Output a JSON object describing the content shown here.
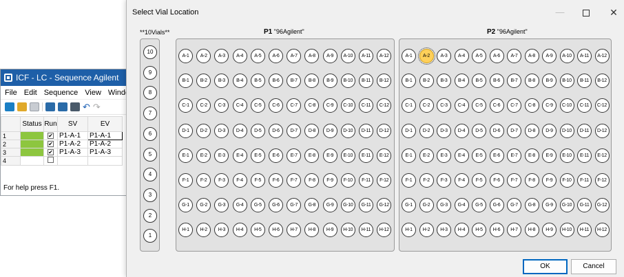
{
  "background_window": {
    "title": "ICF - LC - Sequence Agilent",
    "menu": [
      "File",
      "Edit",
      "Sequence",
      "View",
      "Windo"
    ],
    "columns": [
      "",
      "Status",
      "Run",
      "SV",
      "EV"
    ],
    "rows": [
      {
        "num": "1",
        "status": "ok",
        "run": true,
        "sv": "P1-A-1",
        "ev": "P1-A-1"
      },
      {
        "num": "2",
        "status": "ok",
        "run": true,
        "sv": "P1-A-2",
        "ev": "P1-A-2"
      },
      {
        "num": "3",
        "status": "ok",
        "run": true,
        "sv": "P1-A-3",
        "ev": "P1-A-3"
      },
      {
        "num": "4",
        "status": "",
        "run": false,
        "sv": "",
        "ev": ""
      }
    ],
    "status_text": "For help press F1."
  },
  "dialog": {
    "title": "Select Vial Location",
    "vial_tray_label": "**10Vials**",
    "vials": [
      "10",
      "9",
      "8",
      "7",
      "6",
      "5",
      "4",
      "3",
      "2",
      "1"
    ],
    "plates": [
      {
        "name": "P1",
        "type": "\"96Agilent\"",
        "selected": ""
      },
      {
        "name": "P2",
        "type": "\"96Agilent\"",
        "selected": "A-2"
      }
    ],
    "rows": [
      "A",
      "B",
      "C",
      "D",
      "E",
      "F",
      "G",
      "H"
    ],
    "cols": 12,
    "ok_label": "OK",
    "cancel_label": "Cancel"
  },
  "colors": {
    "selected_well": "#ffd05a",
    "status_ok": "#8dc63f",
    "titlebar": "#1e5fa8"
  }
}
